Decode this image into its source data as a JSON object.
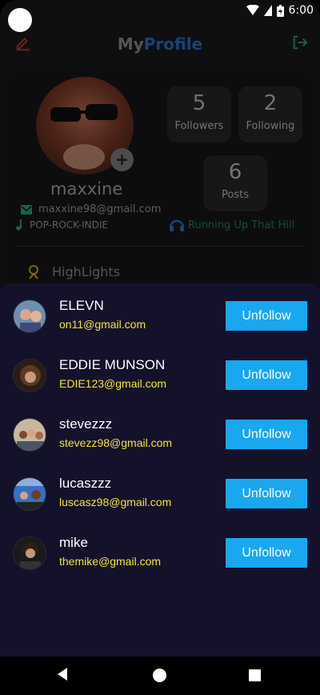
{
  "status": {
    "time": "6:00"
  },
  "header": {
    "title_my": "My",
    "title_profile": "Profile"
  },
  "profile": {
    "username": "maxxine",
    "email": "maxxine98@gmail.com",
    "genres": "POP-ROCK-INDIE",
    "song": "Running Up That Hill",
    "stats": {
      "followers": {
        "value": "5",
        "label": "Followers"
      },
      "following": {
        "value": "2",
        "label": "Following"
      },
      "posts": {
        "value": "6",
        "label": "Posts"
      }
    },
    "highlights_label": "HighLights"
  },
  "following_list": [
    {
      "name": "ELEVN",
      "email": "on11@gmail.com",
      "button": "Unfollow"
    },
    {
      "name": "EDDIE MUNSON",
      "email": "EDIE123@gmail.com",
      "button": "Unfollow"
    },
    {
      "name": "stevezzz",
      "email": "stevezz98@gmail.com",
      "button": "Unfollow"
    },
    {
      "name": "lucaszzz",
      "email": "luscasz98@gmail.com",
      "button": "Unfollow"
    },
    {
      "name": "mike",
      "email": "themike@gmail.com",
      "button": "Unfollow"
    }
  ],
  "colors": {
    "accent_blue": "#19a7f0",
    "email_yellow": "#f2e23a",
    "sheet_bg": "#14112b",
    "title_blue": "#2a7bd8",
    "song_green": "#1f8b6a"
  },
  "icons": {
    "edit": "edit-icon",
    "logout": "logout-icon",
    "mail": "mail-icon",
    "music": "music-note-icon",
    "headphones": "headphones-icon",
    "highlights": "trophy-icon",
    "add": "plus-icon"
  }
}
